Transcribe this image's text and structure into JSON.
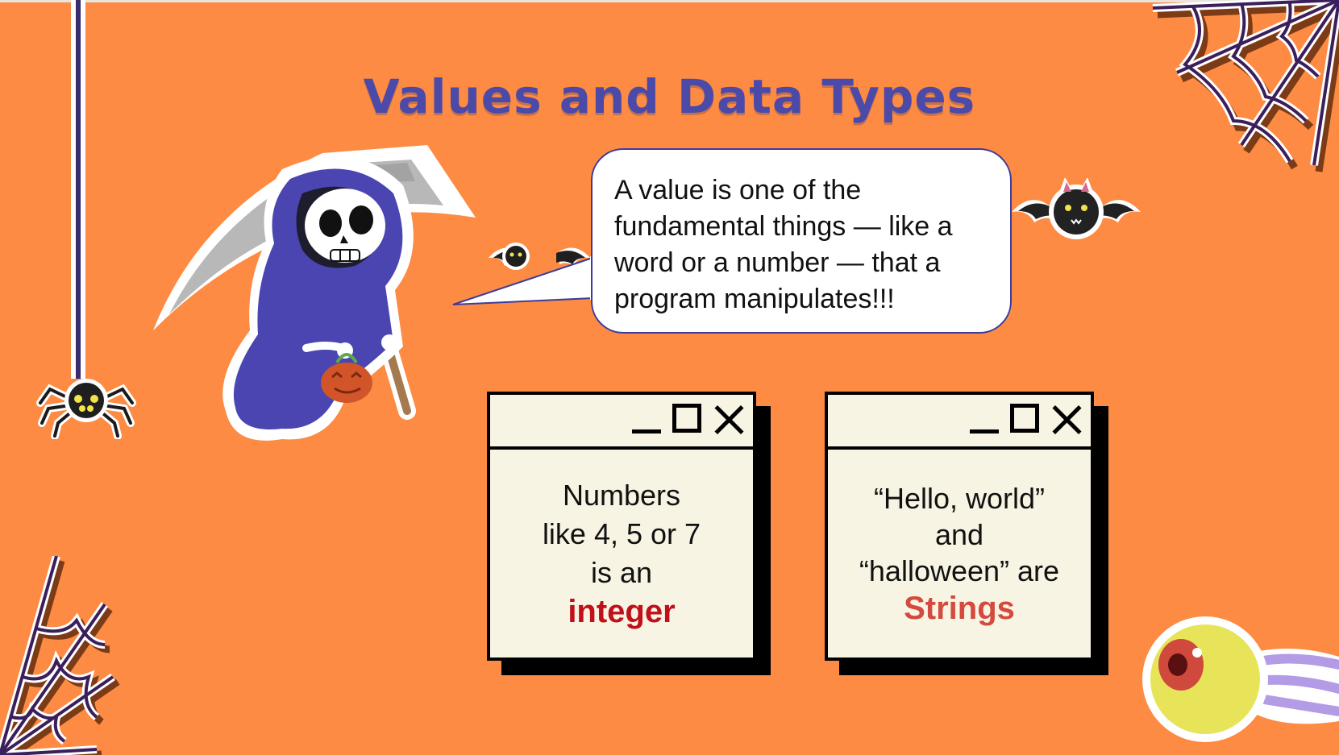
{
  "slide": {
    "title": "Values and Data Types",
    "bubble_text": "A value is one of the fundamental things — like a word or a number — that a program manipulates!!!"
  },
  "windows": [
    {
      "lines": [
        "Numbers",
        "like 4, 5 or 7",
        "is an"
      ],
      "highlight": "integer"
    },
    {
      "lines": [
        "“Hello, world”",
        "and",
        "“halloween” are"
      ],
      "highlight": "Strings"
    }
  ],
  "colors": {
    "background": "#fd8b44",
    "title": "#4b4aa8",
    "integer": "#c0101a",
    "strings": "#d44a3e",
    "window_fill": "#f8f4e4"
  },
  "icons": [
    "minimize-icon",
    "maximize-icon",
    "close-icon",
    "spider-web-icon",
    "spider-icon",
    "bat-icon",
    "grim-reaper-illustration",
    "eyeball-icon"
  ]
}
